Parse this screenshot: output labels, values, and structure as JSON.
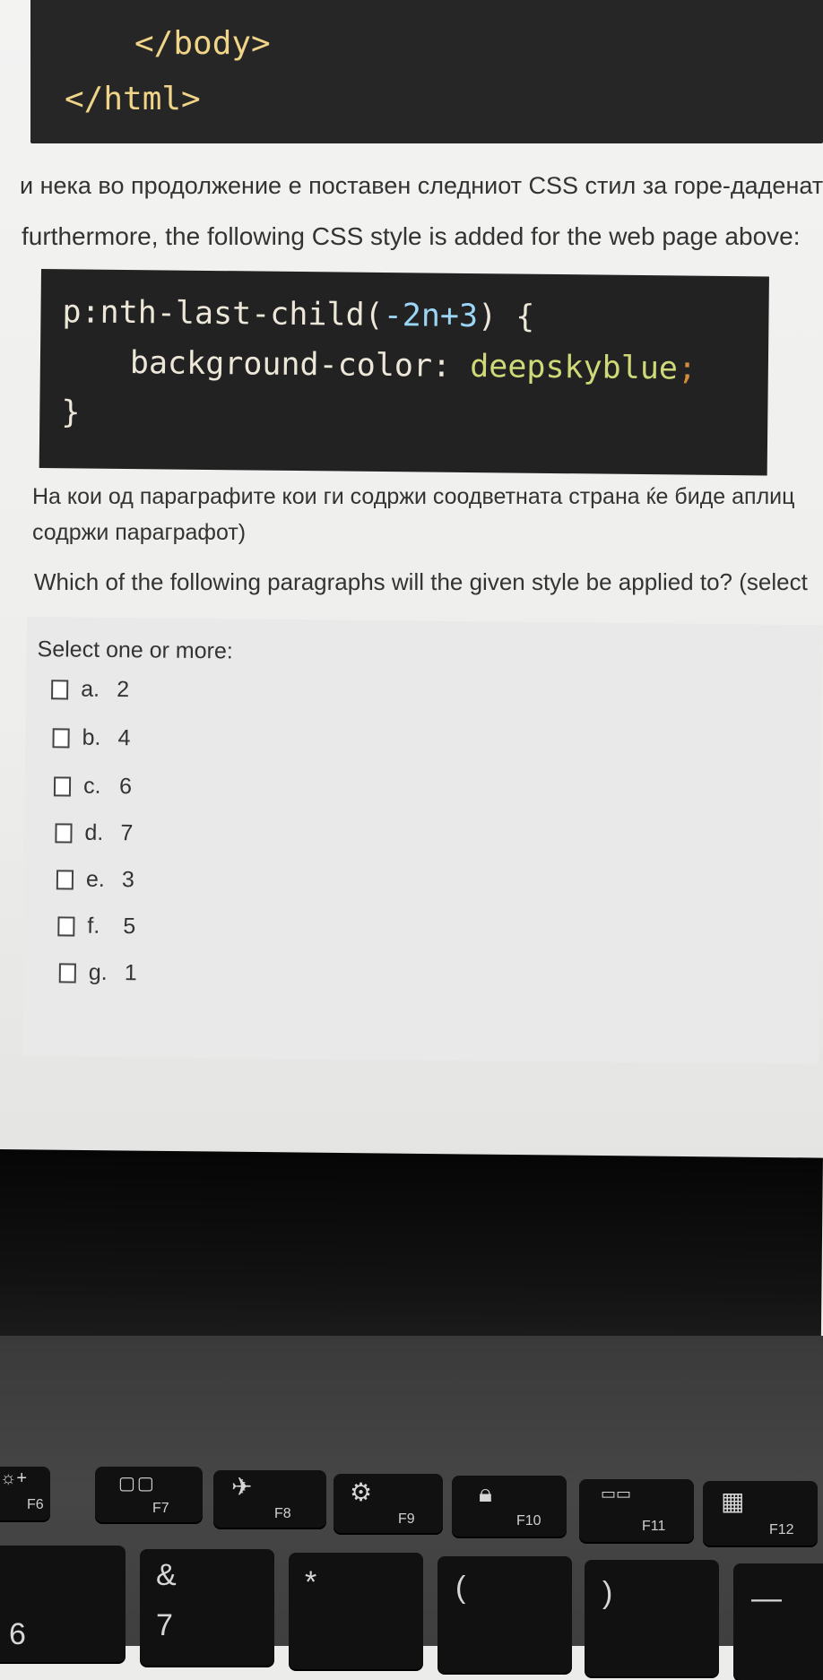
{
  "code_top": {
    "line1": "</body>",
    "line2": "</html>"
  },
  "intro_mk": "и нека во продолжение е поставен следниот CSS стил за горе-даденат",
  "intro_en": "furthermore, the following CSS style is added for the web page above:",
  "css": {
    "selector": "p:nth-last-child(",
    "arg": "-2n+3",
    "selector_end": ") {",
    "property": "background-color: ",
    "value": "deepskyblue",
    "semicolon": ";",
    "close": "}"
  },
  "question_mk_1": "На кои од параграфите кои ги содржи соодветната страна ќе биде аплиц",
  "question_mk_2": "содржи параграфот)",
  "question_en": "Which of the following paragraphs will the given style be applied to? (select",
  "select_prompt": "Select one or more:",
  "options": [
    {
      "letter": "a.",
      "value": "2"
    },
    {
      "letter": "b.",
      "value": "4"
    },
    {
      "letter": "c.",
      "value": "6"
    },
    {
      "letter": "d.",
      "value": "7"
    },
    {
      "letter": "e.",
      "value": "3"
    },
    {
      "letter": "f.",
      "value": "5"
    },
    {
      "letter": "g.",
      "value": "1"
    }
  ],
  "keyboard": {
    "fkeys": [
      "F6",
      "F7",
      "F8",
      "F9",
      "F10",
      "F11",
      "F12"
    ],
    "symbols": [
      "&",
      "7",
      "*",
      "(",
      ")",
      "—",
      "6"
    ]
  }
}
